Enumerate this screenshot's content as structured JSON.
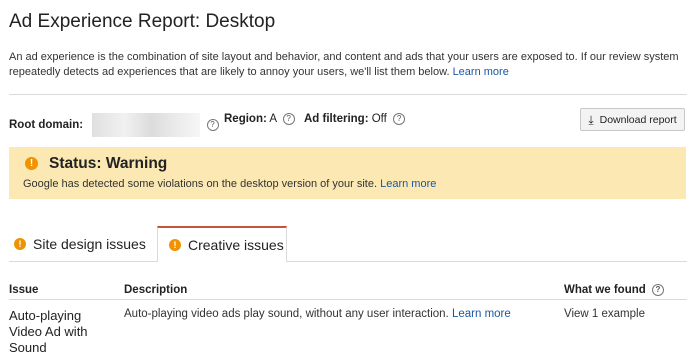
{
  "title": "Ad Experience Report: Desktop",
  "intro": {
    "text": "An ad experience is the combination of site layout and behavior, and content and ads that your users are exposed to. If our review system repeatedly detects ad experiences that are likely to annoy your users, we'll list them below.",
    "link": "Learn more"
  },
  "meta": {
    "root_domain_label": "Root domain:",
    "region_label": "Region:",
    "region_value": "A",
    "ad_filtering_label": "Ad filtering:",
    "ad_filtering_value": "Off",
    "help_glyph": "?"
  },
  "download_button": {
    "label": "Download report",
    "icon": "download-icon"
  },
  "status": {
    "icon": "warning-icon",
    "icon_glyph": "!",
    "title": "Status: Warning",
    "text": "Google has detected some violations on the desktop version of your site.",
    "link": "Learn more",
    "background": "#fbe8b3",
    "accent": "#f09300"
  },
  "tabs": [
    {
      "label": "Site design issues",
      "active": false
    },
    {
      "label": "Creative issues",
      "active": true
    }
  ],
  "table": {
    "headers": [
      "Issue",
      "Description",
      "What we found"
    ],
    "rows": [
      {
        "issue": "Auto-playing Video Ad with Sound",
        "description": "Auto-playing video ads play sound, without any user interaction.",
        "description_link": "Learn more",
        "found": "View 1 example"
      }
    ]
  },
  "colors": {
    "link": "#1a57a8",
    "active_tab_border": "#c6543b"
  }
}
